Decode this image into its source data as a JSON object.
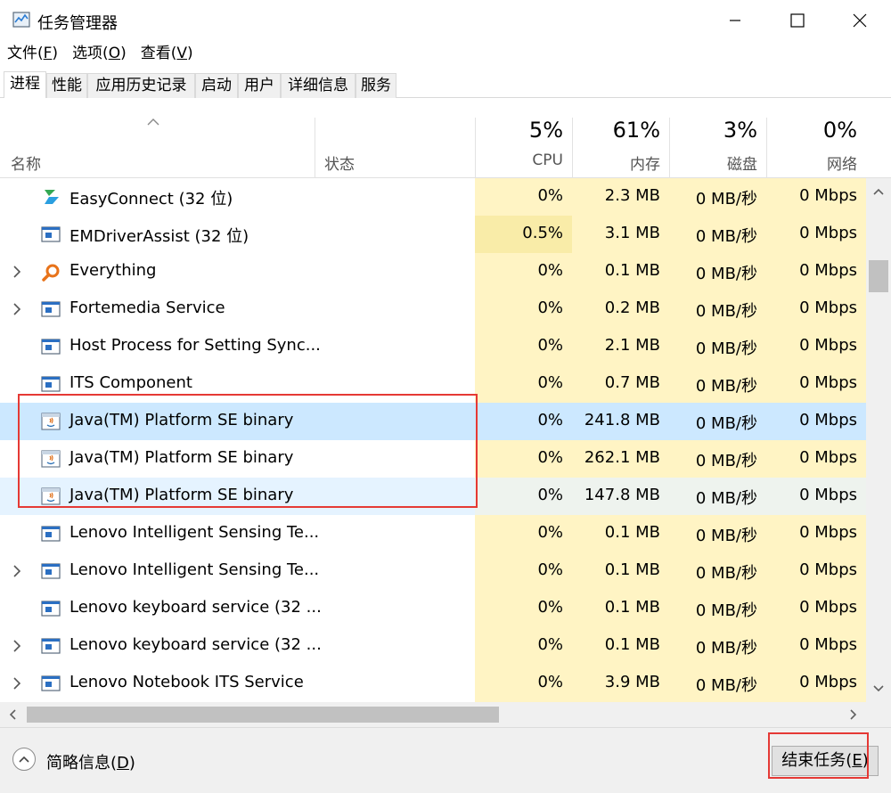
{
  "window": {
    "title": "任务管理器"
  },
  "menu": [
    {
      "pre": "文件(",
      "u": "F",
      "post": ")"
    },
    {
      "pre": "选项(",
      "u": "O",
      "post": ")"
    },
    {
      "pre": "查看(",
      "u": "V",
      "post": ")"
    }
  ],
  "tabs": [
    "进程",
    "性能",
    "应用历史记录",
    "启动",
    "用户",
    "详细信息",
    "服务"
  ],
  "active_tab": "进程",
  "columns": {
    "name": "名称",
    "status": "状态",
    "cpu": {
      "percent": "5%",
      "label": "CPU"
    },
    "memory": {
      "percent": "61%",
      "label": "内存"
    },
    "disk": {
      "percent": "3%",
      "label": "磁盘"
    },
    "network": {
      "percent": "0%",
      "label": "网络"
    }
  },
  "processes": [
    {
      "name": "EasyConnect (32 位)",
      "icon": "easyconnect-icon",
      "expandable": false,
      "cpu": "0%",
      "memory": "2.3 MB",
      "disk": "0 MB/秒",
      "network": "0 Mbps"
    },
    {
      "name": "EMDriverAssist (32 位)",
      "icon": "app-window-icon",
      "expandable": false,
      "cpu": "0.5%",
      "memory": "3.1 MB",
      "disk": "0 MB/秒",
      "network": "0 Mbps"
    },
    {
      "name": "Everything",
      "icon": "everything-search-icon",
      "expandable": true,
      "cpu": "0%",
      "memory": "0.1 MB",
      "disk": "0 MB/秒",
      "network": "0 Mbps"
    },
    {
      "name": "Fortemedia Service",
      "icon": "app-window-icon",
      "expandable": true,
      "cpu": "0%",
      "memory": "0.2 MB",
      "disk": "0 MB/秒",
      "network": "0 Mbps"
    },
    {
      "name": "Host Process for Setting Sync...",
      "icon": "app-window-icon",
      "expandable": false,
      "cpu": "0%",
      "memory": "2.1 MB",
      "disk": "0 MB/秒",
      "network": "0 Mbps"
    },
    {
      "name": "ITS Component",
      "icon": "app-window-icon",
      "expandable": false,
      "cpu": "0%",
      "memory": "0.7 MB",
      "disk": "0 MB/秒",
      "network": "0 Mbps"
    },
    {
      "name": "Java(TM) Platform SE binary",
      "icon": "java-icon",
      "expandable": false,
      "cpu": "0%",
      "memory": "241.8 MB",
      "disk": "0 MB/秒",
      "network": "0 Mbps"
    },
    {
      "name": "Java(TM) Platform SE binary",
      "icon": "java-icon",
      "expandable": false,
      "cpu": "0%",
      "memory": "262.1 MB",
      "disk": "0 MB/秒",
      "network": "0 Mbps"
    },
    {
      "name": "Java(TM) Platform SE binary",
      "icon": "java-icon",
      "expandable": false,
      "cpu": "0%",
      "memory": "147.8 MB",
      "disk": "0 MB/秒",
      "network": "0 Mbps"
    },
    {
      "name": "Lenovo Intelligent Sensing Te...",
      "icon": "app-window-icon",
      "expandable": false,
      "cpu": "0%",
      "memory": "0.1 MB",
      "disk": "0 MB/秒",
      "network": "0 Mbps"
    },
    {
      "name": "Lenovo Intelligent Sensing Te...",
      "icon": "app-window-icon",
      "expandable": true,
      "cpu": "0%",
      "memory": "0.1 MB",
      "disk": "0 MB/秒",
      "network": "0 Mbps"
    },
    {
      "name": "Lenovo keyboard service (32 ...",
      "icon": "app-window-icon",
      "expandable": false,
      "cpu": "0%",
      "memory": "0.1 MB",
      "disk": "0 MB/秒",
      "network": "0 Mbps"
    },
    {
      "name": "Lenovo keyboard service (32 ...",
      "icon": "app-window-icon",
      "expandable": true,
      "cpu": "0%",
      "memory": "0.1 MB",
      "disk": "0 MB/秒",
      "network": "0 Mbps"
    },
    {
      "name": "Lenovo Notebook ITS Service",
      "icon": "app-window-icon",
      "expandable": true,
      "cpu": "0%",
      "memory": "3.9 MB",
      "disk": "0 MB/秒",
      "network": "0 Mbps"
    }
  ],
  "footer": {
    "fewer_details": {
      "pre": "简略信息(",
      "u": "D",
      "post": ")"
    },
    "end_task": {
      "pre": "结束任务(",
      "u": "E",
      "post": ")"
    }
  },
  "colors": {
    "heat_low": "#fff4c4",
    "heat_mid": "#f9eca8",
    "selected": "#cce8ff",
    "hover": "#e5f3ff",
    "highlight_box": "#e53935"
  }
}
